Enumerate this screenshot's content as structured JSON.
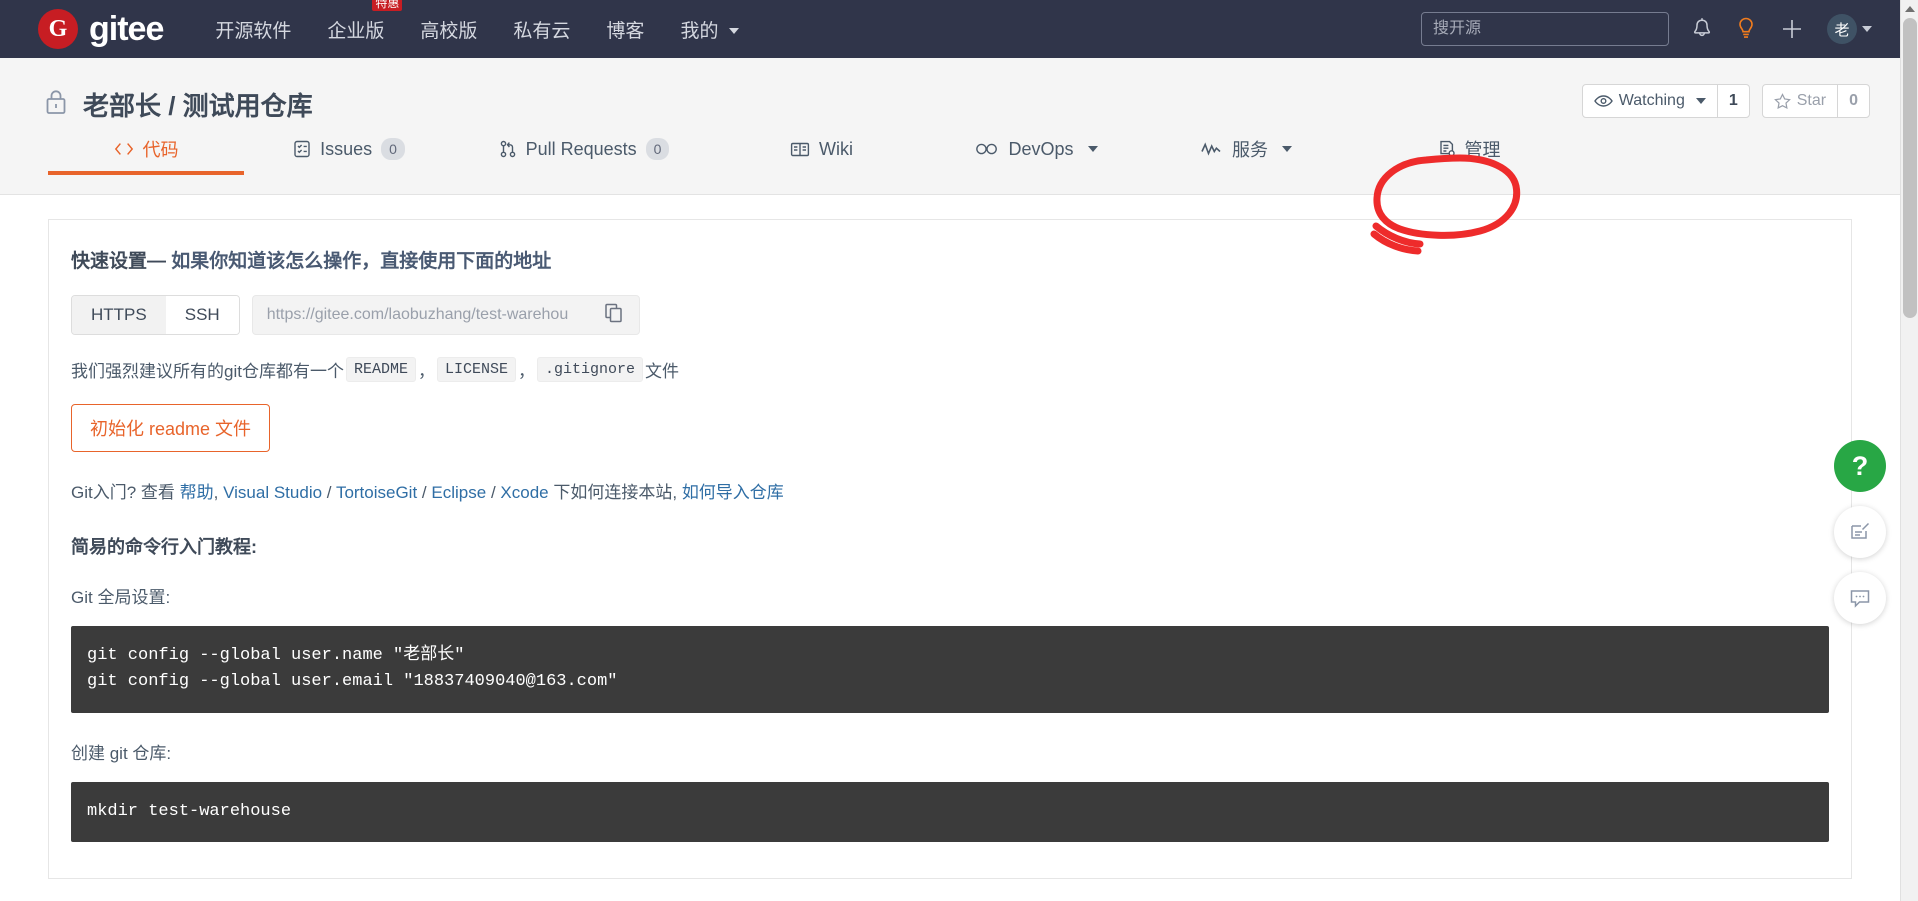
{
  "topnav": {
    "logo_letter": "G",
    "logo_text": "gitee",
    "items": [
      {
        "label": "开源软件",
        "badge": null,
        "caret": false
      },
      {
        "label": "企业版",
        "badge": "特惠",
        "caret": false
      },
      {
        "label": "高校版",
        "badge": null,
        "caret": false
      },
      {
        "label": "私有云",
        "badge": null,
        "caret": false
      },
      {
        "label": "博客",
        "badge": null,
        "caret": false
      },
      {
        "label": "我的",
        "badge": null,
        "caret": true
      }
    ],
    "search_placeholder": "搜开源",
    "icons": [
      "bell-icon",
      "lightbulb-icon",
      "plus-icon"
    ],
    "avatar_letter": "老"
  },
  "repo": {
    "visibility_icon": "lock-icon",
    "owner": "老部长",
    "separator": "/",
    "name": "测试用仓库",
    "full_title": "老部长 / 测试用仓库",
    "watching_label": "Watching",
    "watching_count": "1",
    "star_label": "Star",
    "star_count": "0"
  },
  "tabs": [
    {
      "label": "代码",
      "icon": "code-icon",
      "count": null,
      "caret": false,
      "active": true
    },
    {
      "label": "Issues",
      "icon": "issue-icon",
      "count": "0",
      "caret": false,
      "active": false
    },
    {
      "label": "Pull Requests",
      "icon": "pull-request-icon",
      "count": "0",
      "caret": false,
      "active": false
    },
    {
      "label": "Wiki",
      "icon": "book-icon",
      "count": null,
      "caret": false,
      "active": false
    },
    {
      "label": "DevOps",
      "icon": "infinity-icon",
      "count": null,
      "caret": true,
      "active": false
    },
    {
      "label": "服务",
      "icon": "pulse-icon",
      "count": null,
      "caret": true,
      "active": false
    },
    {
      "label": "管理",
      "icon": "settings-doc-icon",
      "count": null,
      "caret": false,
      "active": false
    }
  ],
  "quick_setup": {
    "title_bold": "快速设置—",
    "title_rest": "如果你知道该怎么操作，直接使用下面的地址",
    "protocol_https": "HTTPS",
    "protocol_ssh": "SSH",
    "active_protocol": "HTTPS",
    "clone_url": "https://gitee.com/laobuzhang/test-warehou",
    "copy_icon": "copy-icon",
    "recommend_prefix": "我们强烈建议所有的git仓库都有一个",
    "chip_readme": "README",
    "chip_license": "LICENSE",
    "chip_gitignore": ".gitignore",
    "recommend_suffix": "文件",
    "comma": "，",
    "init_readme_button": "初始化 readme 文件"
  },
  "git_intro": {
    "prefix": "Git入门?",
    "view": "查看",
    "help_link": "帮助",
    "comma": ",",
    "vs": "Visual Studio",
    "tortoise": "TortoiseGit",
    "eclipse": "Eclipse",
    "xcode": "Xcode",
    "middle": "下如何连接本站,",
    "import_link": "如何导入仓库",
    "slash": "/"
  },
  "tutorial": {
    "heading": "简易的命令行入门教程:",
    "global_label": "Git 全局设置:",
    "global_code": "git config --global user.name \"老部长\"\ngit config --global user.email \"18837409040@163.com\"",
    "create_label": "创建 git 仓库:",
    "create_code": "mkdir test-warehouse"
  },
  "floating": {
    "help_label": "?",
    "feedback_icon": "edit-feedback-icon",
    "chat_icon": "chat-bubble-icon"
  },
  "colors": {
    "navbar_bg": "#30354a",
    "brand_red": "#c71d23",
    "accent_orange": "#e8642b",
    "link_blue": "#2f6ea5",
    "annotation_red": "#ee2b2b",
    "code_bg": "#3b3b3b",
    "help_green": "#28a745"
  }
}
